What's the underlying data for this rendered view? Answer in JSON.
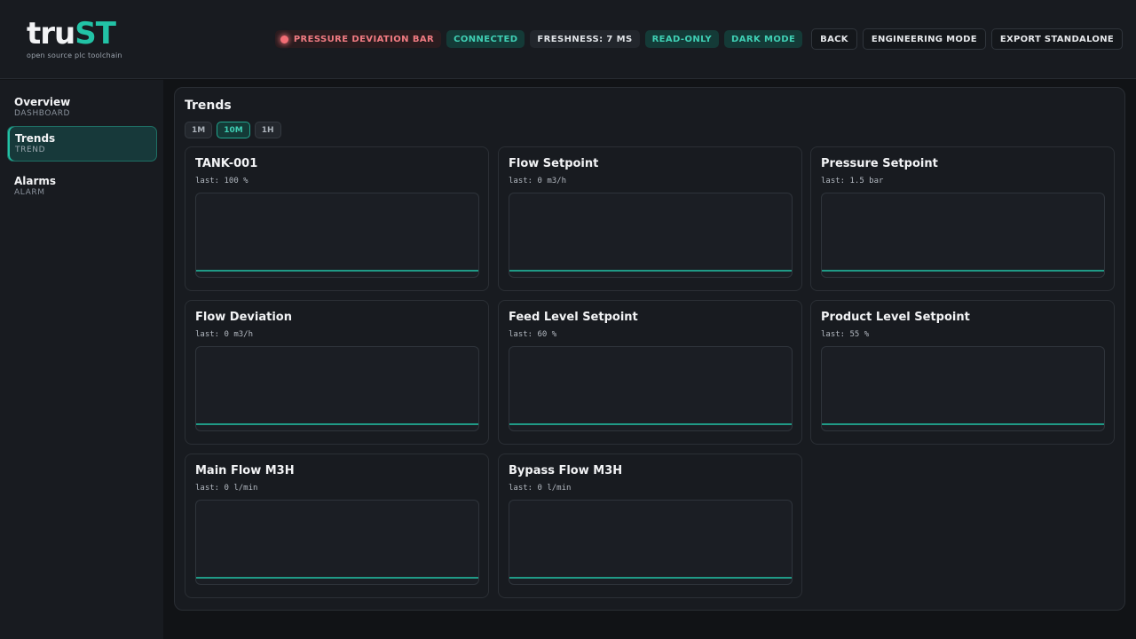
{
  "brand": {
    "name_part1": "tru",
    "name_part2": "ST",
    "tagline": "open source plc toolchain",
    "accent_color": "#22c3a6"
  },
  "header": {
    "alarm_status": "PRESSURE DEVIATION BAR",
    "connection_status": "CONNECTED",
    "freshness": "FRESHNESS: 7 MS",
    "access_mode": "READ-ONLY",
    "theme_mode": "DARK MODE",
    "back_label": "BACK",
    "engineering_label": "ENGINEERING MODE",
    "export_label": "EXPORT STANDALONE"
  },
  "sidebar": {
    "items": [
      {
        "label": "Overview",
        "sub": "DASHBOARD",
        "active": false
      },
      {
        "label": "Trends",
        "sub": "TREND",
        "active": true
      },
      {
        "label": "Alarms",
        "sub": "ALARM",
        "active": false
      }
    ]
  },
  "main": {
    "title": "Trends",
    "ranges": [
      {
        "label": "1M",
        "active": false
      },
      {
        "label": "10M",
        "active": true
      },
      {
        "label": "1H",
        "active": false
      }
    ],
    "cards": [
      {
        "title": "TANK-001",
        "last": "last: 100 %"
      },
      {
        "title": "Flow Setpoint",
        "last": "last: 0 m3/h"
      },
      {
        "title": "Pressure Setpoint",
        "last": "last: 1.5 bar"
      },
      {
        "title": "Flow Deviation",
        "last": "last: 0 m3/h"
      },
      {
        "title": "Feed Level Setpoint",
        "last": "last: 60 %"
      },
      {
        "title": "Product Level Setpoint",
        "last": "last: 55 %"
      },
      {
        "title": "Main Flow M3H",
        "last": "last: 0 l/min"
      },
      {
        "title": "Bypass Flow M3H",
        "last": "last: 0 l/min"
      }
    ]
  }
}
